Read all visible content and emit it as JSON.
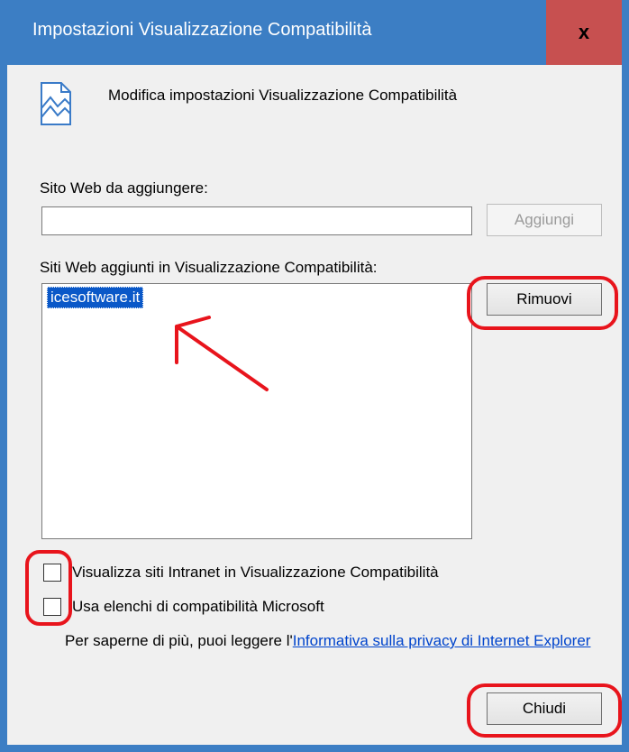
{
  "window": {
    "title": "Impostazioni Visualizzazione Compatibilità",
    "close_glyph": "x"
  },
  "header": {
    "icon": "broken-page-icon",
    "text": "Modifica impostazioni Visualizzazione Compatibilità"
  },
  "add_site": {
    "label": "Sito Web da aggiungere:",
    "input_value": "",
    "add_button": "Aggiungi"
  },
  "sites": {
    "label": "Siti Web aggiunti in Visualizzazione Compatibilità:",
    "items": [
      "icesoftware.it"
    ],
    "remove_button": "Rimuovi"
  },
  "options": {
    "intranet_label": "Visualizza siti Intranet in Visualizzazione Compatibilità",
    "intranet_checked": false,
    "microsoft_lists_label": "Usa elenchi di compatibilità Microsoft",
    "microsoft_lists_checked": false
  },
  "info": {
    "prefix": "Per saperne di più, puoi leggere l'",
    "link_text": "Informativa sulla privacy di Internet Explorer"
  },
  "footer": {
    "close_button": "Chiudi"
  },
  "annotation_color": "#e8141c"
}
